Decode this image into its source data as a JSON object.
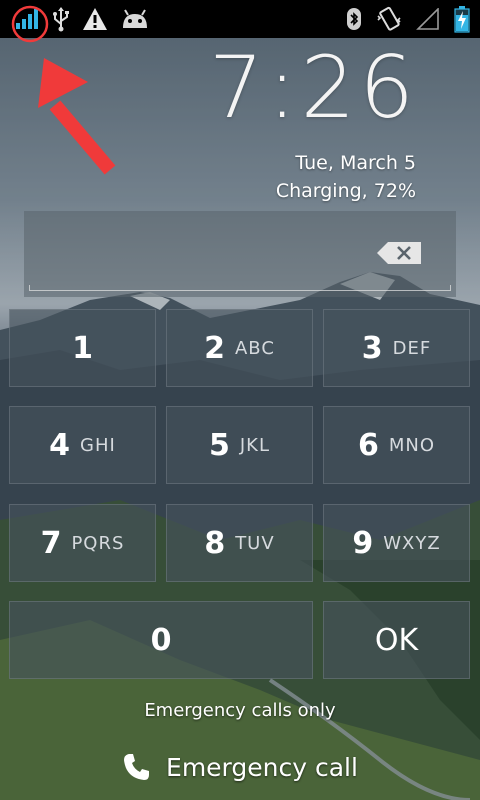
{
  "status_bar": {
    "left_icons": [
      "signal-strength-icon",
      "usb-icon",
      "warning-icon",
      "android-debug-icon"
    ],
    "right_icons": [
      "bluetooth-icon",
      "vibrate-icon",
      "wifi-empty-icon",
      "battery-charging-icon"
    ],
    "battery_color": "#33b5e5"
  },
  "lockscreen": {
    "time": "7:26",
    "date": "Tue, March 5",
    "charging": "Charging, 72%"
  },
  "pin": {
    "value": "",
    "backspace_icon": "backspace-icon"
  },
  "keypad": {
    "keys": [
      {
        "digit": "1",
        "letters": ""
      },
      {
        "digit": "2",
        "letters": "ABC"
      },
      {
        "digit": "3",
        "letters": "DEF"
      },
      {
        "digit": "4",
        "letters": "GHI"
      },
      {
        "digit": "5",
        "letters": "JKL"
      },
      {
        "digit": "6",
        "letters": "MNO"
      },
      {
        "digit": "7",
        "letters": "PQRS"
      },
      {
        "digit": "8",
        "letters": "TUV"
      },
      {
        "digit": "9",
        "letters": "WXYZ"
      },
      {
        "digit": "0",
        "letters": ""
      }
    ],
    "ok_label": "OK"
  },
  "footer": {
    "emergency_only": "Emergency calls only",
    "emergency_call_label": "Emergency call",
    "emergency_call_icon": "phone-icon"
  },
  "annotation": {
    "color": "#f03a3a"
  }
}
